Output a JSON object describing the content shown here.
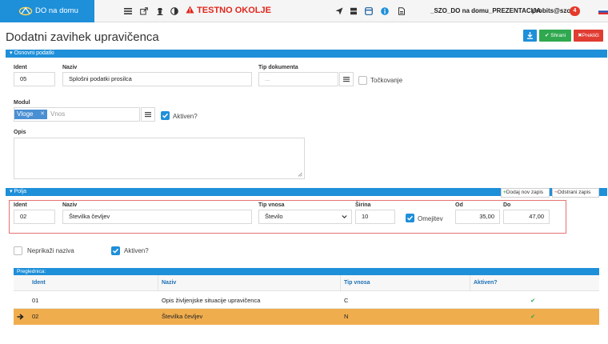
{
  "nav": {
    "brand": "DO na domu",
    "env_warning": "TESTNO OKOLJE",
    "environment": "_SZO_DO na domu_PREZENTACIJA",
    "user": "probits@szo",
    "notifications": "4"
  },
  "page": {
    "title": "Dodatni zavihek upravičenca",
    "save_label": "Shrani",
    "cancel_label": "Prekliči"
  },
  "basic": {
    "section_title": "Osnovni podatki",
    "ident_label": "Ident",
    "ident_value": "05",
    "name_label": "Naziv",
    "name_value": "Splošni podatki prosilca",
    "doctype_label": "Tip dokumenta",
    "doctype_value": "...",
    "tockovanje_label": "Točkovanje",
    "module_label": "Modul",
    "module_tag": "Vloge",
    "module_placeholder": "Vnos",
    "active_label": "Aktiven?",
    "description_label": "Opis"
  },
  "fields": {
    "section_title": "Polja",
    "add_label": "Dodaj nov zapis",
    "remove_label": "Odstrani zapis",
    "ident_label": "Ident",
    "ident_value": "02",
    "name_label": "Naziv",
    "name_value": "Številka čevljev",
    "input_type_label": "Tip vnosa",
    "input_type_value": "Število",
    "width_label": "Širina",
    "width_value": "10",
    "limited_label": "Omejitev",
    "from_label": "Od",
    "from_value": "35,00",
    "to_label": "Do",
    "to_value": "47,00",
    "hide_name_label": "Neprikaži naziva",
    "active_label": "Aktiven?"
  },
  "grid": {
    "title": "Preglednica:",
    "columns": [
      "Ident",
      "Naziv",
      "Tip vnosa",
      "Aktiven?"
    ],
    "rows": [
      {
        "ident": "01",
        "name": "Opis življenjske situacije upravičenca",
        "type": "C",
        "active": "✔"
      },
      {
        "ident": "02",
        "name": "Številka čevljev",
        "type": "N",
        "active": "✔"
      }
    ]
  },
  "colors": {
    "primary": "#1e8fd9",
    "success": "#2fa84f",
    "danger": "#e03c31",
    "selected_row": "#f0ad4e"
  }
}
